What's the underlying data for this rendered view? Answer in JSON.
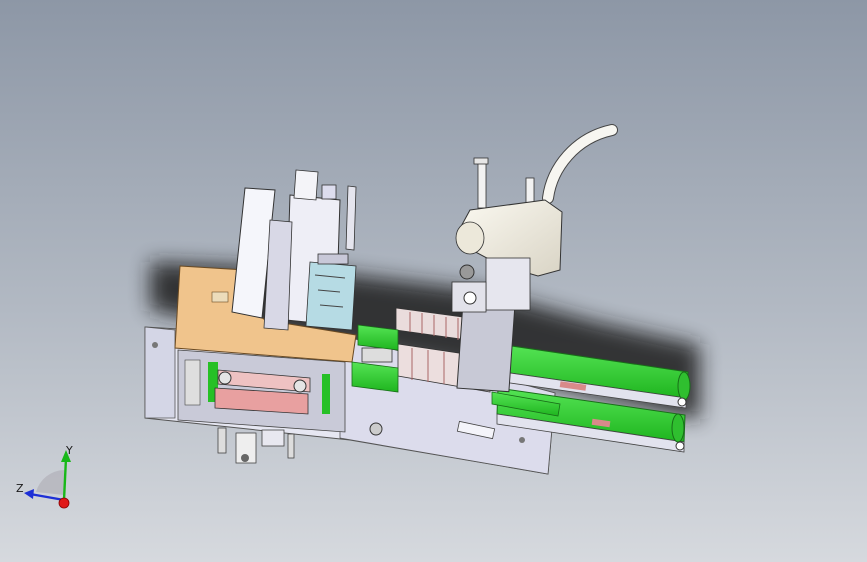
{
  "viewport": {
    "background_top": "#8d97a6",
    "background_bottom": "#d6d9de"
  },
  "model": {
    "frame_color": "#e6e7f2",
    "plate_color": "#f0c48c",
    "conveyor_color": "#2fd12f",
    "robot_color": "#f1eee4",
    "accent_red": "#d98a8a",
    "shadow_color": "#1c1c1c"
  },
  "triad": {
    "x_label": "",
    "y_label": "Y",
    "z_label": "Z",
    "y_color": "#18b818",
    "z_color": "#1d2fd6",
    "x_color": "#e01818"
  }
}
